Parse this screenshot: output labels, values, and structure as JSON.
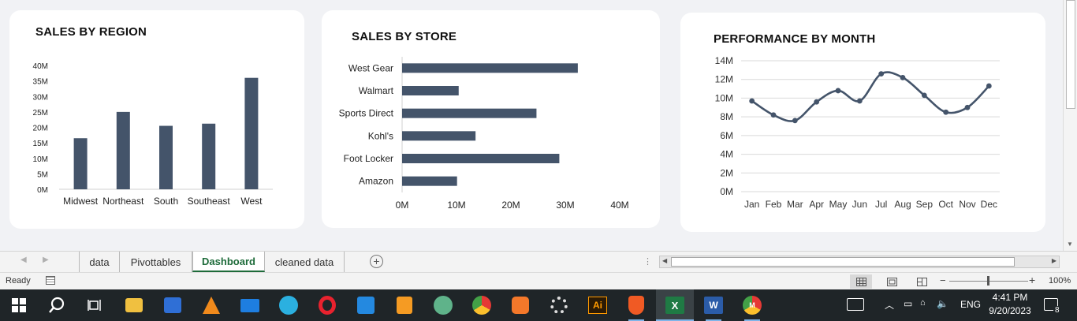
{
  "charts": {
    "region": {
      "title": "SALES BY REGION",
      "chart_data": {
        "type": "bar",
        "title": "SALES BY REGION",
        "categories": [
          "Midwest",
          "Northeast",
          "South",
          "Southeast",
          "West"
        ],
        "values": [
          16.5,
          25,
          20.5,
          21.2,
          36
        ],
        "unit": "M",
        "ylim": [
          0,
          40
        ],
        "yticks": [
          "0M",
          "5M",
          "10M",
          "15M",
          "20M",
          "25M",
          "30M",
          "35M",
          "40M"
        ],
        "grid": false,
        "color": "#44546a"
      }
    },
    "store": {
      "title": "SALES BY STORE",
      "chart_data": {
        "type": "bar",
        "orientation": "horizontal",
        "title": "SALES BY STORE",
        "categories": [
          "West Gear",
          "Walmart",
          "Sports Direct",
          "Kohl's",
          "Foot Locker",
          "Amazon"
        ],
        "values": [
          32.3,
          10.4,
          24.7,
          13.5,
          28.9,
          10.1
        ],
        "unit": "M",
        "xlim": [
          0,
          40
        ],
        "xticks": [
          "0M",
          "10M",
          "20M",
          "30M",
          "40M"
        ],
        "grid": false,
        "color": "#44546a"
      }
    },
    "month": {
      "title": "PERFORMANCE BY MONTH",
      "chart_data": {
        "type": "line",
        "title": "PERFORMANCE BY MONTH",
        "categories": [
          "Jan",
          "Feb",
          "Mar",
          "Apr",
          "May",
          "Jun",
          "Jul",
          "Aug",
          "Sep",
          "Oct",
          "Nov",
          "Dec"
        ],
        "values": [
          9.7,
          8.2,
          7.6,
          9.6,
          10.8,
          9.7,
          12.6,
          12.2,
          10.3,
          8.5,
          9.0,
          11.3
        ],
        "unit": "M",
        "ylim": [
          0,
          14
        ],
        "yticks": [
          "0M",
          "2M",
          "4M",
          "6M",
          "8M",
          "10M",
          "12M",
          "14M"
        ],
        "grid": true,
        "smooth": true,
        "color": "#44546a"
      }
    }
  },
  "sheet_tabs": {
    "tabs": [
      {
        "label": "data",
        "active": false
      },
      {
        "label": "Pivottables",
        "active": false
      },
      {
        "label": "Dashboard",
        "active": true
      },
      {
        "label": "cleaned data",
        "active": false
      }
    ],
    "add_icon": "plus-circle-icon"
  },
  "status": {
    "ready_text": "Ready",
    "zoom_label": "100%",
    "zoom_fraction": 0.5
  },
  "taskbar": {
    "apps": [
      {
        "name": "file-explorer",
        "label": ""
      },
      {
        "name": "microsoft-store",
        "label": ""
      },
      {
        "name": "vlc",
        "label": ""
      },
      {
        "name": "mail",
        "label": ""
      },
      {
        "name": "edge",
        "label": ""
      },
      {
        "name": "opera",
        "label": ""
      },
      {
        "name": "vscode",
        "label": ""
      },
      {
        "name": "sublime-text",
        "label": ""
      },
      {
        "name": "atom",
        "label": ""
      },
      {
        "name": "chrome",
        "label": ""
      },
      {
        "name": "xampp",
        "label": ""
      },
      {
        "name": "settings",
        "label": ""
      },
      {
        "name": "illustrator",
        "label": "Ai"
      },
      {
        "name": "brave",
        "label": ""
      },
      {
        "name": "excel",
        "label": "X"
      },
      {
        "name": "word",
        "label": "W"
      },
      {
        "name": "chrome-profile",
        "label": "M"
      }
    ],
    "language": "ENG",
    "time": "4:41 PM",
    "date": "9/20/2023",
    "notification_count": "8"
  }
}
